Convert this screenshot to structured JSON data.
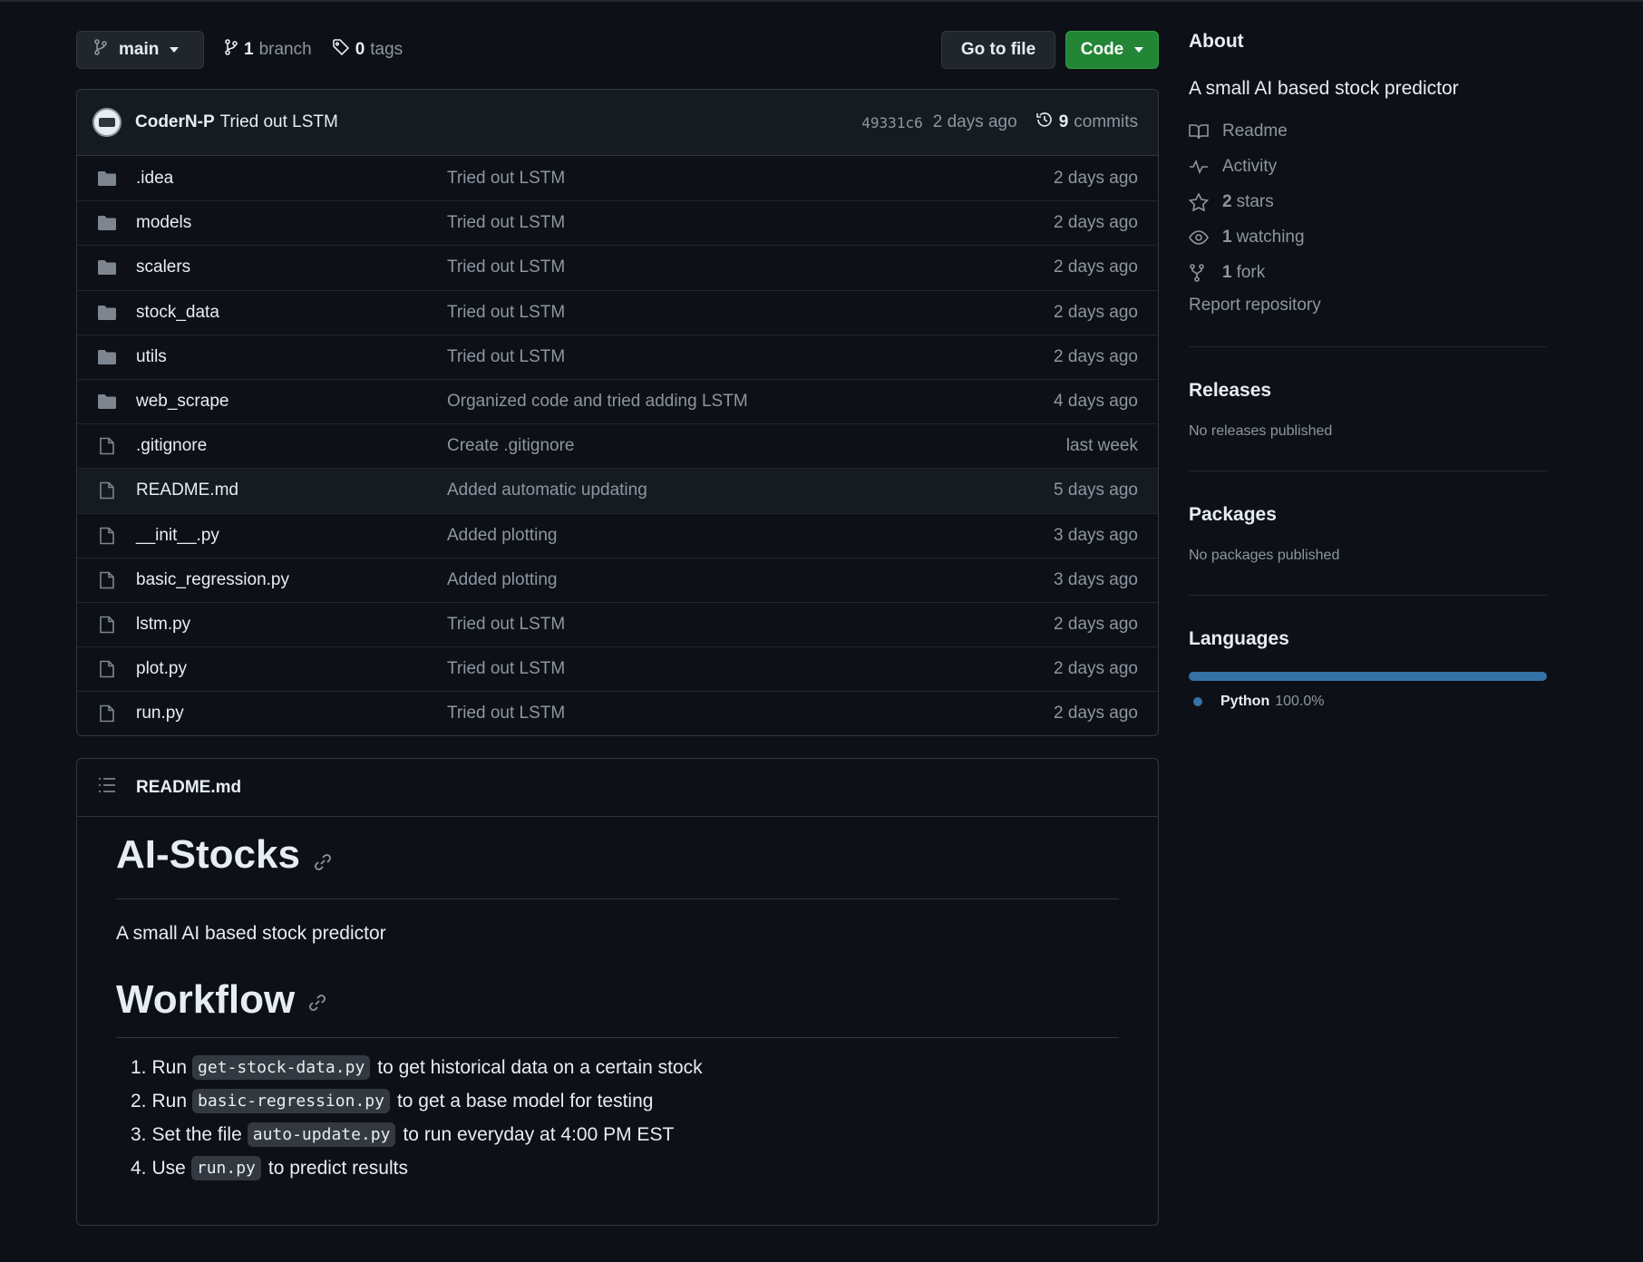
{
  "toolbar": {
    "branch_name": "main",
    "branches_count": "1",
    "branches_label": "branch",
    "tags_count": "0",
    "tags_label": "tags",
    "goto_label": "Go to file",
    "code_label": "Code"
  },
  "latest_commit": {
    "author": "CoderN-P",
    "message": "Tried out LSTM",
    "sha": "49331c6",
    "ago": "2 days ago",
    "commits_count": "9",
    "commits_label": "commits"
  },
  "files": [
    {
      "type": "folder",
      "name": ".idea",
      "message": "Tried out LSTM",
      "date": "2 days ago"
    },
    {
      "type": "folder",
      "name": "models",
      "message": "Tried out LSTM",
      "date": "2 days ago"
    },
    {
      "type": "folder",
      "name": "scalers",
      "message": "Tried out LSTM",
      "date": "2 days ago"
    },
    {
      "type": "folder",
      "name": "stock_data",
      "message": "Tried out LSTM",
      "date": "2 days ago"
    },
    {
      "type": "folder",
      "name": "utils",
      "message": "Tried out LSTM",
      "date": "2 days ago"
    },
    {
      "type": "folder",
      "name": "web_scrape",
      "message": "Organized code and tried adding LSTM",
      "date": "4 days ago"
    },
    {
      "type": "file",
      "name": ".gitignore",
      "message": "Create .gitignore",
      "date": "last week"
    },
    {
      "type": "file",
      "name": "README.md",
      "message": "Added automatic updating",
      "date": "5 days ago"
    },
    {
      "type": "file",
      "name": "__init__.py",
      "message": "Added plotting",
      "date": "3 days ago"
    },
    {
      "type": "file",
      "name": "basic_regression.py",
      "message": "Added plotting",
      "date": "3 days ago"
    },
    {
      "type": "file",
      "name": "lstm.py",
      "message": "Tried out LSTM",
      "date": "2 days ago"
    },
    {
      "type": "file",
      "name": "plot.py",
      "message": "Tried out LSTM",
      "date": "2 days ago"
    },
    {
      "type": "file",
      "name": "run.py",
      "message": "Tried out LSTM",
      "date": "2 days ago"
    }
  ],
  "readme": {
    "filename": "README.md",
    "title": "AI-Stocks",
    "description": "A small AI based stock predictor",
    "workflow_heading": "Workflow",
    "steps": [
      {
        "num": "1.",
        "before": "Run",
        "code": "get-stock-data.py",
        "after": "to get historical data on a certain stock"
      },
      {
        "num": "2.",
        "before": "Run",
        "code": "basic-regression.py",
        "after": "to get a base model for testing"
      },
      {
        "num": "3.",
        "before": "Set the file",
        "code": "auto-update.py",
        "after": "to run everyday at 4:00 PM EST"
      },
      {
        "num": "4.",
        "before": "Use",
        "code": "run.py",
        "after": "to predict results"
      }
    ]
  },
  "about": {
    "heading": "About",
    "description": "A small AI based stock predictor",
    "readme_label": "Readme",
    "activity_label": "Activity",
    "stars_count": "2",
    "stars_label": "stars",
    "watching_count": "1",
    "watching_label": "watching",
    "forks_count": "1",
    "forks_label": "fork",
    "report_label": "Report repository"
  },
  "releases": {
    "heading": "Releases",
    "empty": "No releases published"
  },
  "packages": {
    "heading": "Packages",
    "empty": "No packages published"
  },
  "languages": {
    "heading": "Languages",
    "items": [
      {
        "name": "Python",
        "percent": "100.0%",
        "fraction": 1.0,
        "color": "#3572A5"
      }
    ]
  },
  "colors": {
    "background": "#0d1117",
    "accent_green": "#238636",
    "muted_text": "#8d96a0",
    "border": "#30363d",
    "python": "#3572A5"
  }
}
